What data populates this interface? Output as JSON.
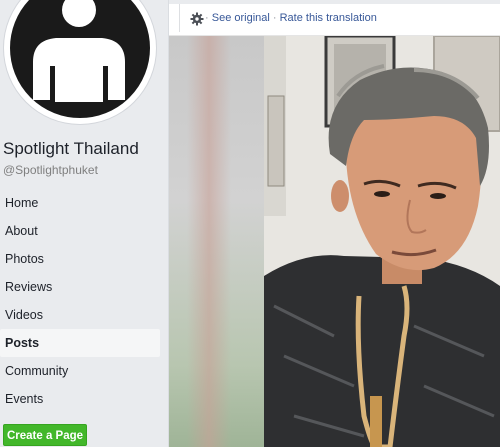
{
  "sidebar": {
    "page_name": "Spotlight Thailand",
    "page_handle": "@Spotlightphuket",
    "nav": [
      {
        "label": "Home",
        "active": false
      },
      {
        "label": "About",
        "active": false
      },
      {
        "label": "Photos",
        "active": false
      },
      {
        "label": "Reviews",
        "active": false
      },
      {
        "label": "Videos",
        "active": false
      },
      {
        "label": "Posts",
        "active": true
      },
      {
        "label": "Community",
        "active": false
      },
      {
        "label": "Events",
        "active": false
      }
    ],
    "create_page_label": "Create a Page"
  },
  "translation_bar": {
    "separator": " · ",
    "see_original": "See original",
    "rate_translation": "Rate this translation",
    "icon": "gear-icon"
  },
  "colors": {
    "create_button": "#42b72a",
    "link": "#385898",
    "sidebar_bg": "#e9ebee"
  }
}
